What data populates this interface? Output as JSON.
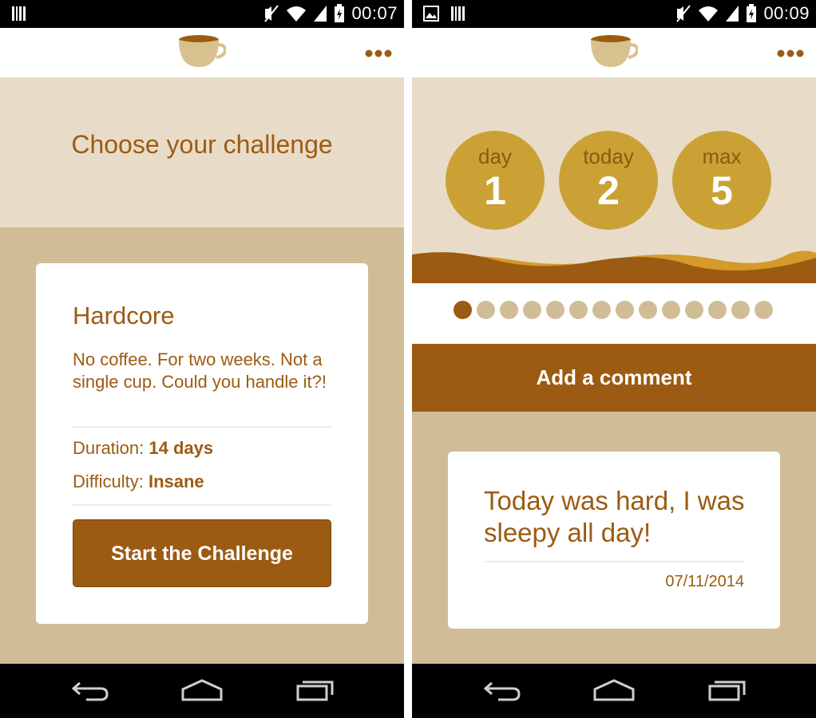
{
  "colors": {
    "brand_brown": "#9c5b12",
    "accent_gold": "#cba136",
    "light_beige": "#e8dcc8",
    "tan": "#d0bd97",
    "bar_black": "#000000"
  },
  "icons": {
    "logo": "coffee-cup-icon",
    "menu": "more-horizontal-icon",
    "back": "back-arrow-icon",
    "home": "home-icon",
    "recents": "recent-apps-icon"
  },
  "left_screen": {
    "status_time": "00:07",
    "hero_title": "Choose your challenge",
    "card": {
      "title": "Hardcore",
      "description": "No coffee. For two weeks. Not a single cup. Could you handle it?!",
      "duration_label": "Duration:",
      "duration_value": "14 days",
      "difficulty_label": "Difficulty:",
      "difficulty_value": "Insane",
      "button_label": "Start the Challenge"
    }
  },
  "right_screen": {
    "status_time": "00:09",
    "counters": [
      {
        "label": "day",
        "value": "1"
      },
      {
        "label": "today",
        "value": "2"
      },
      {
        "label": "max",
        "value": "5"
      }
    ],
    "pager_total": 14,
    "pager_active": 1,
    "comment_button_label": "Add a comment",
    "comment": {
      "text": "Today was hard, I was sleepy all day!",
      "date": "07/11/2014"
    }
  }
}
